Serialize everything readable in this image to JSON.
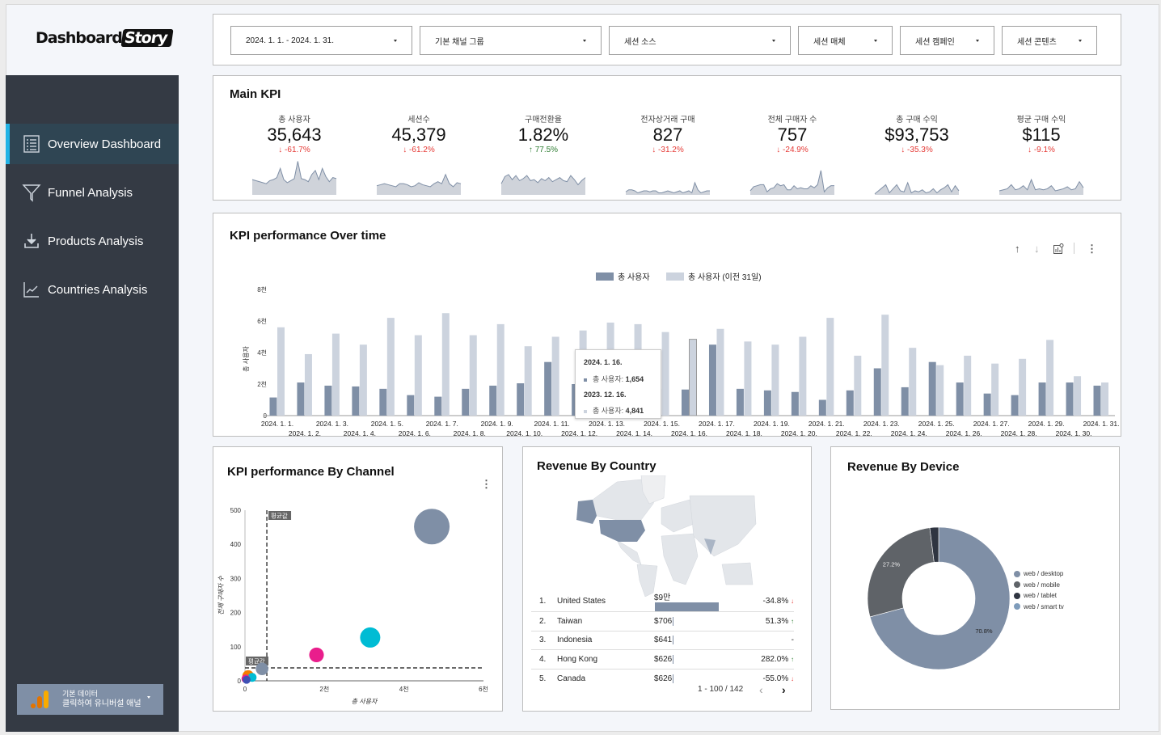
{
  "brand": {
    "name_part1": "Dashboard",
    "name_part2": "Story"
  },
  "sidebar": {
    "items": [
      {
        "label": "Overview Dashboard",
        "icon": "list-icon",
        "active": true
      },
      {
        "label": "Funnel Analysis",
        "icon": "funnel-icon",
        "active": false
      },
      {
        "label": "Products Analysis",
        "icon": "download-icon",
        "active": false
      },
      {
        "label": "Countries Analysis",
        "icon": "line-chart-icon",
        "active": false
      }
    ],
    "data_source": {
      "line1": "기본 데이터",
      "line2": "클릭하여 유니버설 애널"
    }
  },
  "filters": [
    {
      "label": "2024. 1. 1. - 2024. 1. 31."
    },
    {
      "label": "기본 채널 그룹"
    },
    {
      "label": "세션 소스"
    },
    {
      "label": "세션 매체"
    },
    {
      "label": "세션 캠페인"
    },
    {
      "label": "세션 콘텐츠"
    }
  ],
  "main_kpi": {
    "title": "Main KPI",
    "items": [
      {
        "label": "총 사용자",
        "value": "35,643",
        "change": "-61.7%",
        "dir": "down",
        "spark": [
          30,
          28,
          26,
          24,
          22,
          28,
          30,
          34,
          52,
          30,
          24,
          28,
          32,
          66,
          32,
          30,
          26,
          40,
          48,
          30,
          52,
          36,
          26,
          34,
          32
        ]
      },
      {
        "label": "세션수",
        "value": "45,379",
        "change": "-61.2%",
        "dir": "down",
        "spark": [
          18,
          20,
          22,
          20,
          18,
          16,
          22,
          22,
          20,
          16,
          18,
          24,
          20,
          18,
          16,
          22,
          26,
          22,
          40,
          22,
          16,
          24,
          22
        ]
      },
      {
        "label": "구매전환율",
        "value": "1.82%",
        "change": "77.5%",
        "dir": "up",
        "spark": [
          22,
          36,
          40,
          30,
          38,
          28,
          32,
          38,
          28,
          30,
          24,
          32,
          28,
          34,
          26,
          30,
          34,
          28,
          26,
          38,
          30,
          20,
          28,
          34
        ]
      },
      {
        "label": "전자상거래 구매",
        "value": "827",
        "change": "-31.2%",
        "dir": "down",
        "spark": [
          6,
          10,
          10,
          8,
          4,
          6,
          8,
          8,
          6,
          8,
          8,
          4,
          4,
          6,
          8,
          6,
          4,
          6,
          8,
          4,
          6,
          8,
          4,
          24,
          10,
          4,
          6,
          8,
          8
        ]
      },
      {
        "label": "전체 구매자 수",
        "value": "757",
        "change": "-24.9%",
        "dir": "down",
        "spark": [
          8,
          16,
          18,
          20,
          20,
          6,
          12,
          14,
          22,
          18,
          20,
          10,
          10,
          18,
          12,
          14,
          12,
          12,
          18,
          14,
          20,
          48,
          6,
          14,
          18,
          18
        ]
      },
      {
        "label": "총 구매 수익",
        "value": "$93,753",
        "change": "-35.3%",
        "dir": "down",
        "spark": [
          2,
          8,
          14,
          20,
          4,
          12,
          20,
          8,
          6,
          24,
          4,
          8,
          6,
          10,
          4,
          6,
          12,
          4,
          10,
          14,
          20,
          6,
          18,
          8
        ]
      },
      {
        "label": "평균 구매 수익",
        "value": "$115",
        "change": "-9.1%",
        "dir": "down",
        "spark": [
          8,
          10,
          12,
          20,
          10,
          12,
          18,
          10,
          30,
          10,
          12,
          10,
          12,
          18,
          8,
          10,
          12,
          16,
          10,
          12,
          26,
          14
        ]
      }
    ]
  },
  "kpi_over_time": {
    "title": "KPI performance Over time",
    "toolbar": {
      "sort_up": "arrow-up-icon",
      "sort_down": "arrow-down-icon",
      "chart_option": "chart-settings-icon",
      "more": "more-vert-icon"
    },
    "tooltip": {
      "date1": "2024. 1. 16.",
      "label1": "총 사용자: ",
      "value1": "1,654",
      "date2": "2023. 12. 16.",
      "label2": "총 사용자: ",
      "value2": "4,841"
    }
  },
  "kpi_by_channel": {
    "title": "KPI performance By Channel",
    "avg_label": "평균값"
  },
  "revenue_by_country": {
    "title": "Revenue By Country",
    "rows": [
      {
        "rank": "1.",
        "country": "United States",
        "revenue": "$9만",
        "bar": 1.0,
        "change": "-34.8%",
        "dir": "down"
      },
      {
        "rank": "2.",
        "country": "Taiwan",
        "revenue": "$706",
        "bar": 0.008,
        "change": "51.3%",
        "dir": "up"
      },
      {
        "rank": "3.",
        "country": "Indonesia",
        "revenue": "$641",
        "bar": 0.007,
        "change": "-",
        "dir": "none"
      },
      {
        "rank": "4.",
        "country": "Hong Kong",
        "revenue": "$626",
        "bar": 0.007,
        "change": "282.0%",
        "dir": "up"
      },
      {
        "rank": "5.",
        "country": "Canada",
        "revenue": "$626",
        "bar": 0.007,
        "change": "-55.0%",
        "dir": "down"
      }
    ],
    "pagination": "1 - 100 / 142"
  },
  "revenue_by_device": {
    "title": "Revenue By  Device"
  },
  "colors": {
    "primary": "#7f8fa6",
    "secondary": "#ccd3de",
    "sidebar": "#343a44",
    "active_accent": "#22b3e6",
    "down": "#e53935",
    "up": "#2e7d32"
  },
  "chart_data": [
    {
      "type": "bar",
      "title": "KPI performance Over time",
      "xlabel": "",
      "ylabel": "총 사용자",
      "ylim": [
        0,
        8000
      ],
      "yticks": [
        "0",
        "2천",
        "4천",
        "6천",
        "8천"
      ],
      "legend_position": "top",
      "categories": [
        "2024. 1. 1.",
        "2024. 1. 2.",
        "2024. 1. 3.",
        "2024. 1. 4.",
        "2024. 1. 5.",
        "2024. 1. 6.",
        "2024. 1. 7.",
        "2024. 1. 8.",
        "2024. 1. 9.",
        "2024. 1. 10.",
        "2024. 1. 11.",
        "2024. 1. 12.",
        "2024. 1. 13.",
        "2024. 1. 14.",
        "2024. 1. 15.",
        "2024. 1. 16.",
        "2024. 1. 17.",
        "2024. 1. 18.",
        "2024. 1. 19.",
        "2024. 1. 20.",
        "2024. 1. 21.",
        "2024. 1. 22.",
        "2024. 1. 23.",
        "2024. 1. 24.",
        "2024. 1. 25.",
        "2024. 1. 26.",
        "2024. 1. 27.",
        "2024. 1. 28.",
        "2024. 1. 29.",
        "2024. 1. 30.",
        "2024. 1. 31."
      ],
      "series": [
        {
          "name": "총 사용자",
          "values": [
            1150,
            2100,
            1900,
            1850,
            1700,
            1300,
            1200,
            1700,
            1900,
            2050,
            3400,
            2000,
            1800,
            1900,
            1700,
            1654,
            4500,
            1700,
            1600,
            1500,
            1000,
            1600,
            3000,
            1800,
            3400,
            2100,
            1400,
            1300,
            2100,
            2100,
            1900
          ]
        },
        {
          "name": "총 사용자 (이전 31일)",
          "values": [
            5600,
            3900,
            5200,
            4500,
            6200,
            5100,
            6500,
            5100,
            5800,
            4400,
            5000,
            5400,
            5900,
            5800,
            5300,
            4841,
            5500,
            4700,
            4500,
            5000,
            6200,
            3800,
            6400,
            4300,
            3200,
            3800,
            3300,
            3600,
            4800,
            2500,
            2100
          ]
        }
      ]
    },
    {
      "type": "scatter",
      "title": "KPI performance By Channel",
      "xlabel": "총 사용자",
      "ylabel": "전체 구매자 수",
      "xlim": [
        0,
        6000
      ],
      "ylim": [
        0,
        500
      ],
      "xticks": [
        "0",
        "2천",
        "4천",
        "6천"
      ],
      "yticks": [
        "0",
        "100",
        "200",
        "300",
        "400",
        "500"
      ],
      "reference_lines": {
        "x_avg": 550,
        "y_avg": 38,
        "label": "평균값"
      },
      "points": [
        {
          "x": 4700,
          "y": 452,
          "size": 1.0,
          "color": "#7f8fa6"
        },
        {
          "x": 3150,
          "y": 127,
          "size": 0.5,
          "color": "#00bcd4"
        },
        {
          "x": 1800,
          "y": 76,
          "size": 0.32,
          "color": "#e91e8c"
        },
        {
          "x": 430,
          "y": 35,
          "size": 0.25,
          "color": "#7f8fa6"
        },
        {
          "x": 80,
          "y": 14,
          "size": 0.22,
          "color": "#f57c00"
        },
        {
          "x": 180,
          "y": 10,
          "size": 0.13,
          "color": "#00bcd4"
        },
        {
          "x": 20,
          "y": 6,
          "size": 0.12,
          "color": "#e91e8c"
        },
        {
          "x": 40,
          "y": 3,
          "size": 0.1,
          "color": "#3f51b5"
        }
      ]
    },
    {
      "type": "pie",
      "title": "Revenue By  Device",
      "donut": true,
      "legend_position": "right",
      "slices": [
        {
          "label": "web / desktop",
          "value": 70.8,
          "color": "#7f8fa6",
          "show_label": "70.8%"
        },
        {
          "label": "web / mobile",
          "value": 27.2,
          "color": "#5f6368",
          "show_label": "27.2%"
        },
        {
          "label": "web / tablet",
          "value": 2.0,
          "color": "#2f3541",
          "show_label": ""
        },
        {
          "label": "web / smart tv",
          "value": 0.0,
          "color": "#7f9cbb",
          "show_label": ""
        }
      ]
    }
  ]
}
